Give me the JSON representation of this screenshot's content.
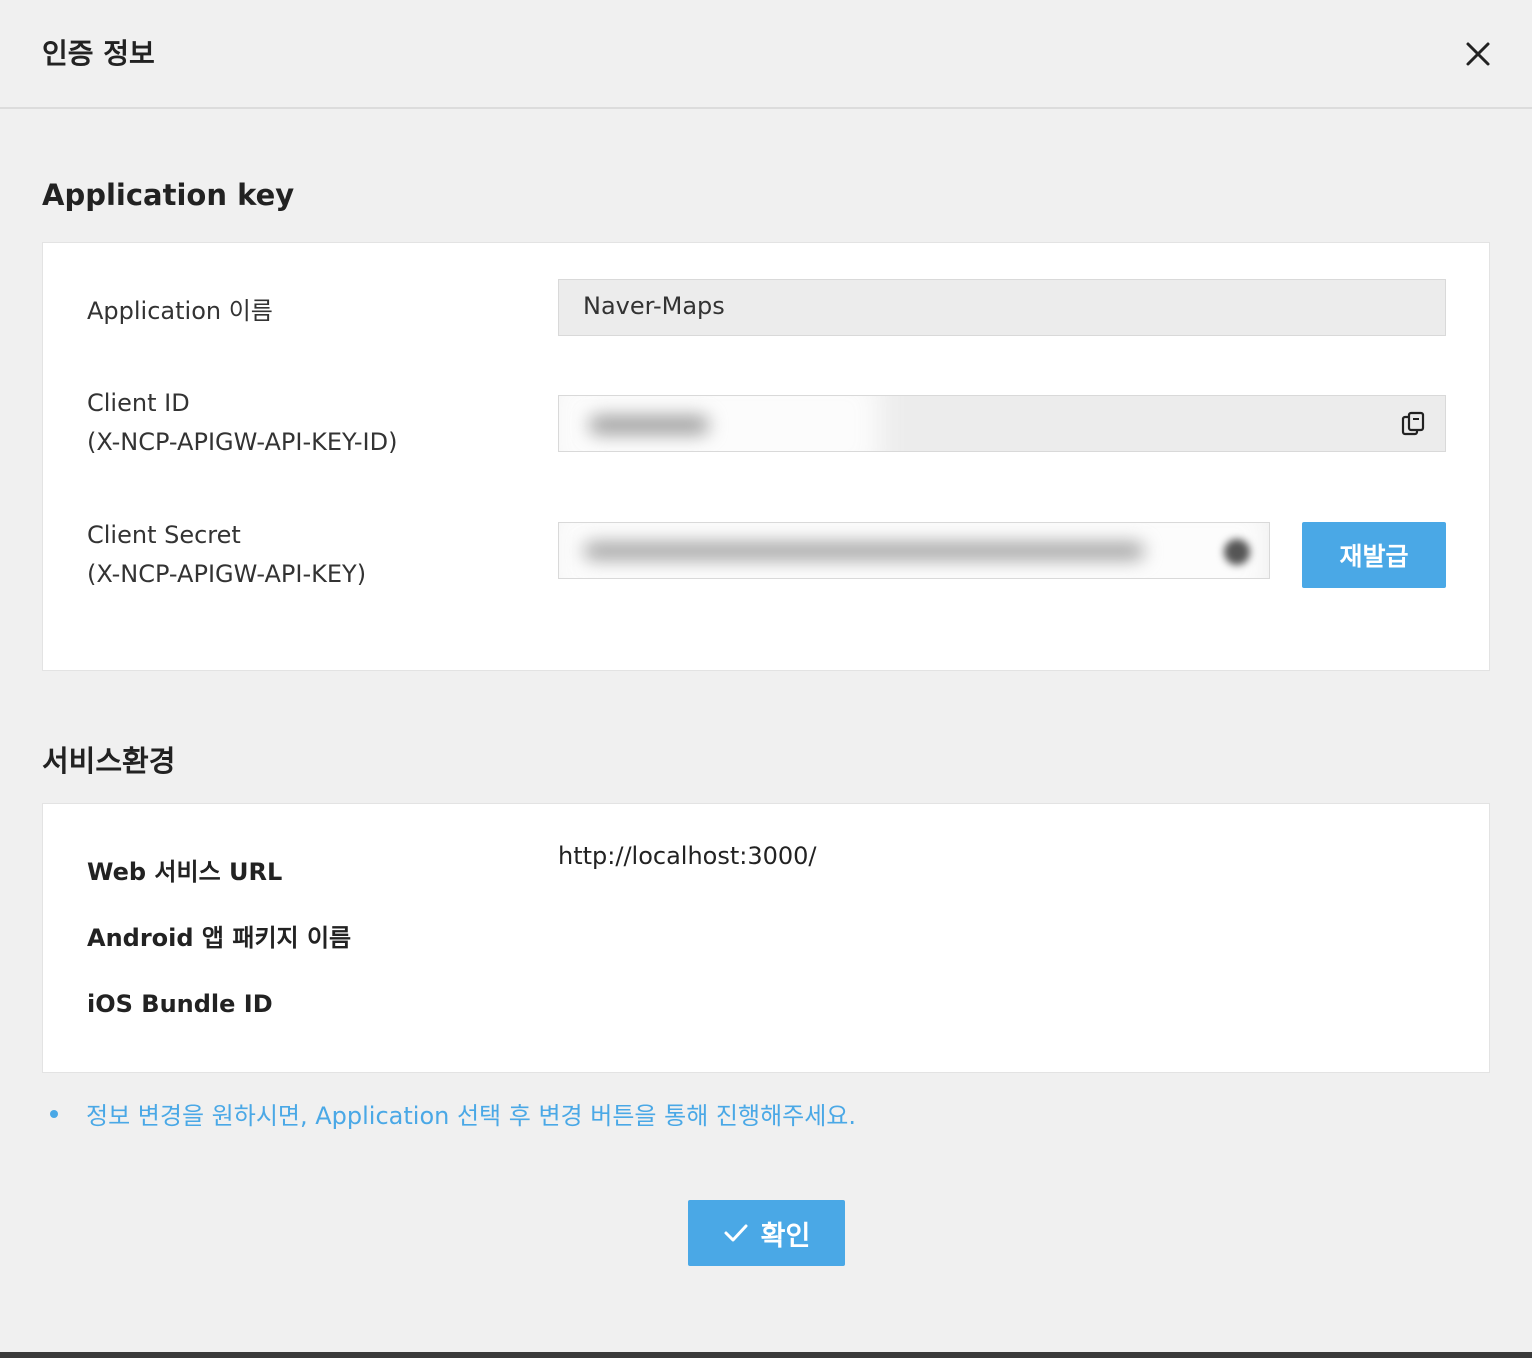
{
  "dialog": {
    "title": "인증 정보",
    "close_icon": "close-icon"
  },
  "app_key_section": {
    "title": "Application key",
    "app_name_label": "Application 이름",
    "app_name_value": "Naver-Maps",
    "client_id_label_line1": "Client ID",
    "client_id_label_line2": "(X-NCP-APIGW-API-KEY-ID)",
    "client_id_value": "",
    "client_id_copy_icon": "copy-icon",
    "client_secret_label_line1": "Client Secret",
    "client_secret_label_line2": "(X-NCP-APIGW-API-KEY)",
    "client_secret_value": "",
    "client_secret_copy_icon": "copy-icon",
    "reissue_label": "재발급"
  },
  "service_env_section": {
    "title": "서비스환경",
    "web_url_label": "Web 서비스 URL",
    "web_url_value": "http://localhost:3000/",
    "android_label": "Android 앱 패키지 이름",
    "ios_label": "iOS Bundle ID"
  },
  "notice": {
    "text": "정보 변경을 원하시면, Application 선택 후 변경 버튼을 통해 진행해주세요."
  },
  "footer": {
    "confirm_label": "확인",
    "confirm_icon": "check-icon"
  },
  "colors": {
    "accent": "#4aa8e6",
    "background": "#f0f0f0",
    "card": "#ffffff",
    "field": "#ececec"
  }
}
